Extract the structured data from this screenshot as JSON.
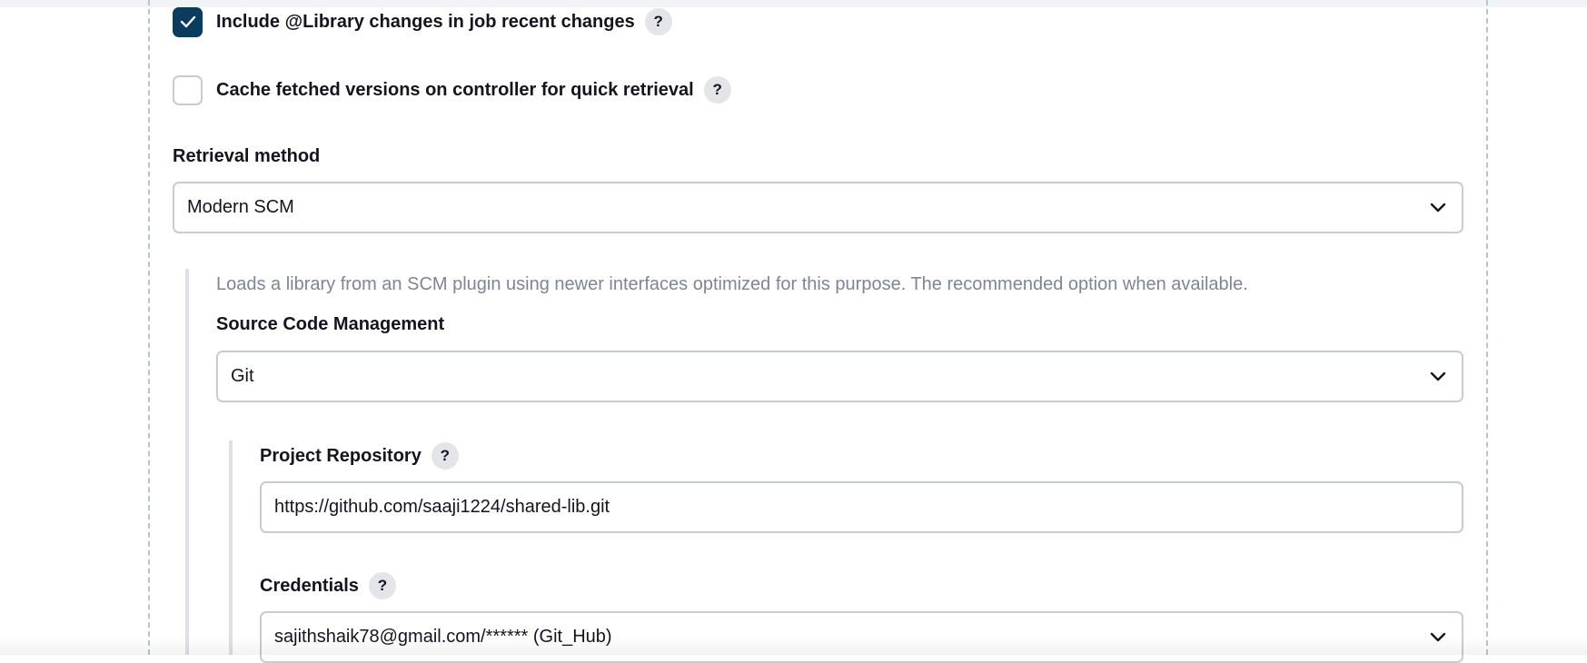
{
  "options": {
    "include_changes": {
      "label": "Include @Library changes in job recent changes",
      "checked": true,
      "help": "?"
    },
    "cache_versions": {
      "label": "Cache fetched versions on controller for quick retrieval",
      "checked": false,
      "help": "?"
    }
  },
  "retrieval": {
    "label": "Retrieval method",
    "selected": "Modern SCM",
    "description": "Loads a library from an SCM plugin using newer interfaces optimized for this purpose. The recommended option when available."
  },
  "scm": {
    "label": "Source Code Management",
    "selected": "Git"
  },
  "repository": {
    "label": "Project Repository",
    "help": "?",
    "value": "https://github.com/saaji1224/shared-lib.git"
  },
  "credentials": {
    "label": "Credentials",
    "help": "?",
    "selected": "sajithshaik78@gmail.com/****** (Git_Hub)"
  },
  "colors": {
    "checkbox_checked": "#0b3b5d",
    "border": "#c6ccd2",
    "muted_text": "#7e8594"
  }
}
